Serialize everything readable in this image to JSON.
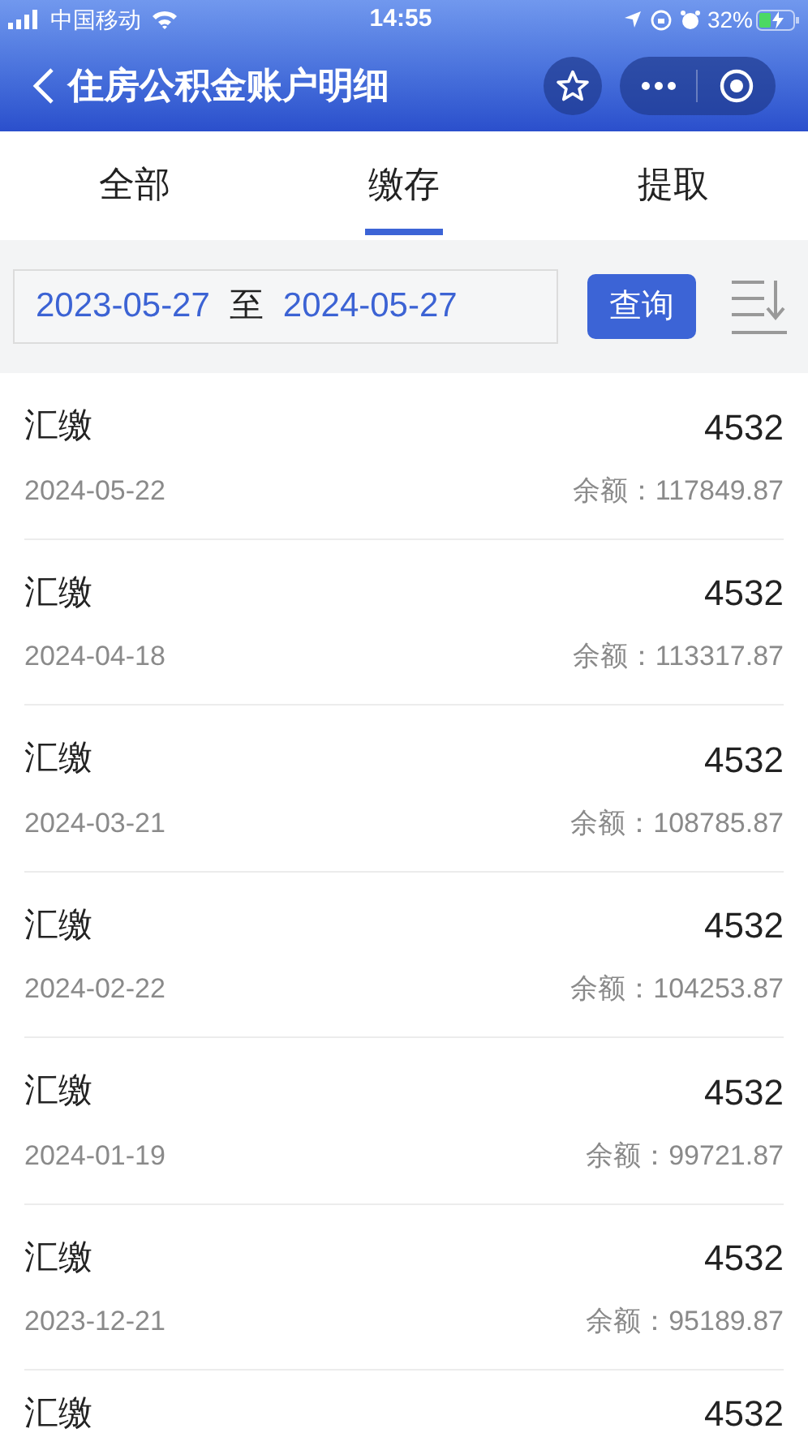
{
  "status_bar": {
    "carrier": "中国移动",
    "time": "14:55",
    "battery": "32%"
  },
  "header": {
    "title": "住房公积金账户明细"
  },
  "tabs": [
    {
      "label": "全部",
      "selected": false
    },
    {
      "label": "缴存",
      "selected": true
    },
    {
      "label": "提取",
      "selected": false
    }
  ],
  "filter": {
    "start_date": "2023-05-27",
    "separator": "至",
    "end_date": "2024-05-27",
    "query_button": "查询"
  },
  "records": [
    {
      "type": "汇缴",
      "amount": "4532",
      "date": "2024-05-22",
      "balance": "余额：117849.87"
    },
    {
      "type": "汇缴",
      "amount": "4532",
      "date": "2024-04-18",
      "balance": "余额：113317.87"
    },
    {
      "type": "汇缴",
      "amount": "4532",
      "date": "2024-03-21",
      "balance": "余额：108785.87"
    },
    {
      "type": "汇缴",
      "amount": "4532",
      "date": "2024-02-22",
      "balance": "余额：104253.87"
    },
    {
      "type": "汇缴",
      "amount": "4532",
      "date": "2024-01-19",
      "balance": "余额：99721.87"
    },
    {
      "type": "汇缴",
      "amount": "4532",
      "date": "2023-12-21",
      "balance": "余额：95189.87"
    },
    {
      "type": "汇缴",
      "amount": "4532"
    }
  ]
}
